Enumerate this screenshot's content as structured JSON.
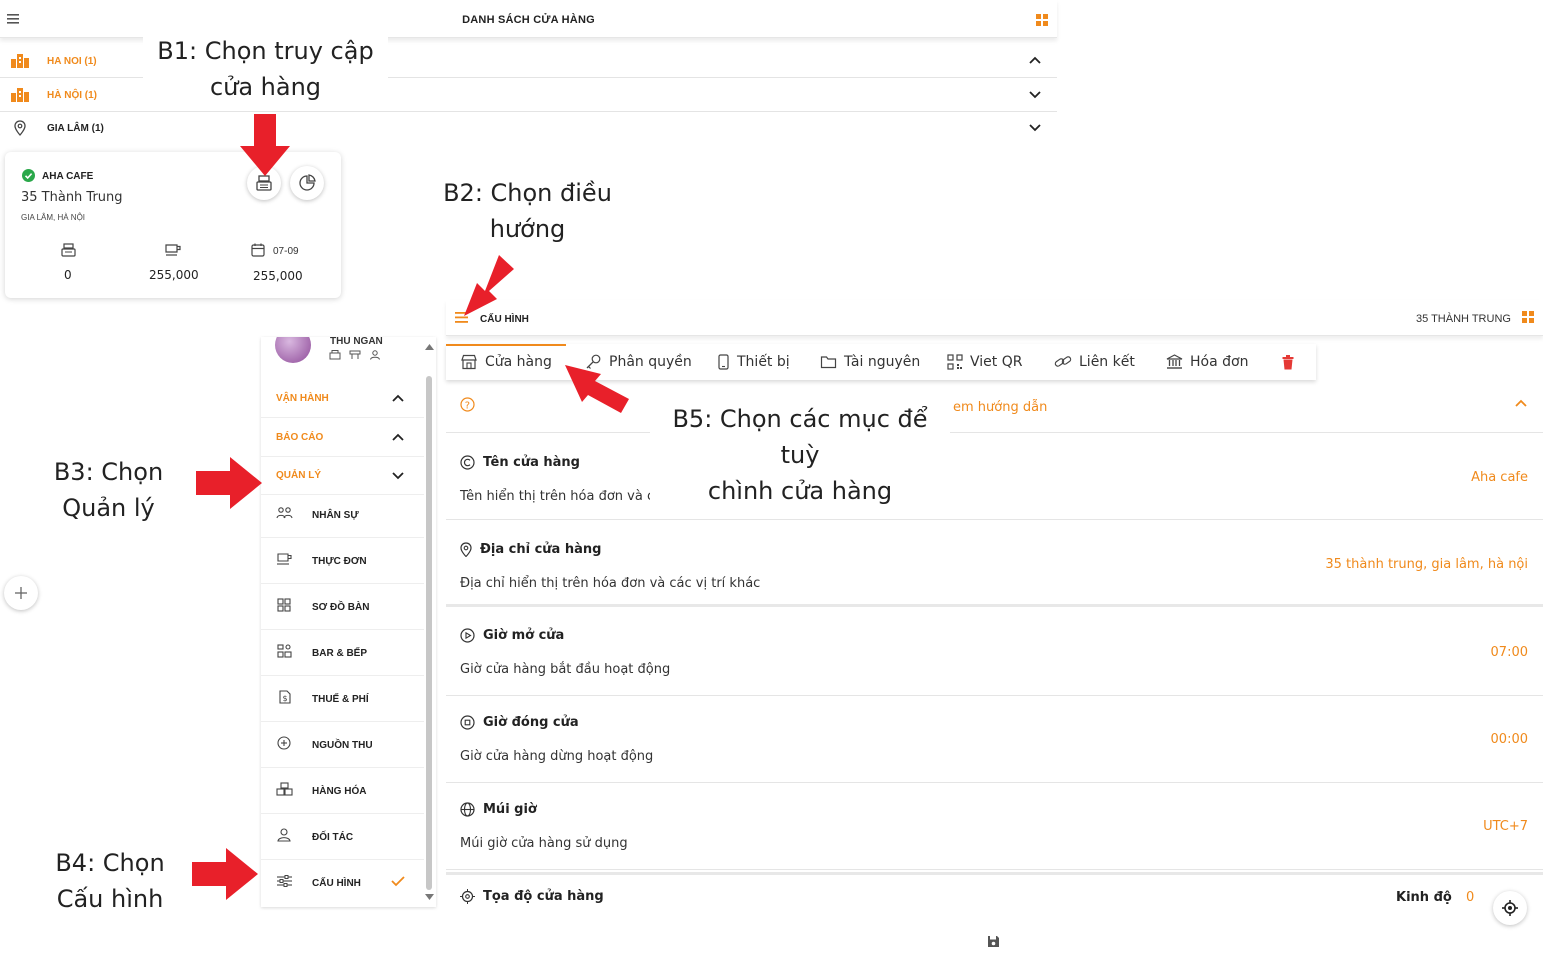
{
  "store_list": {
    "title": "DANH SÁCH CỬA HÀNG",
    "regions": [
      {
        "label": "HA NOI (1)"
      },
      {
        "label": "HÀ NỘI (1)"
      },
      {
        "label": "GIA LÂM (1)"
      }
    ],
    "store": {
      "name": "AHA CAFE",
      "address": "35 Thành Trung",
      "district": "GIA LÂM, HÀ NỘI",
      "date": "07-09",
      "stats": [
        "0",
        "255,000",
        "255,000"
      ]
    }
  },
  "annotations": {
    "b1": "B1: Chọn truy cập\ncửa hàng",
    "b2": "B2: Chọn điều\nhướng",
    "b3": "B3: Chọn\nQuản lý",
    "b4": "B4: Chọn\nCấu hình",
    "b5": "B5: Chọn các mục để tuỳ\nchình cửa hàng"
  },
  "sidebar": {
    "user_label": "THU NGÂN",
    "sections": [
      {
        "label": "VẬN HÀNH"
      },
      {
        "label": "BÁO CÁO"
      },
      {
        "label": "QUẢN LÝ"
      }
    ],
    "items": [
      {
        "label": "NHÂN SỰ",
        "icon": "people-icon"
      },
      {
        "label": "THỰC ĐƠN",
        "icon": "cup-icon"
      },
      {
        "label": "SƠ ĐỒ BÀN",
        "icon": "grid-icon"
      },
      {
        "label": "BAR & BẾP",
        "icon": "kitchen-icon"
      },
      {
        "label": "THUẾ & PHÍ",
        "icon": "tax-icon"
      },
      {
        "label": "NGUỒN THU",
        "icon": "plus-circle-icon"
      },
      {
        "label": "HÀNG HÓA",
        "icon": "boxes-icon"
      },
      {
        "label": "ĐỐI TÁC",
        "icon": "partner-icon"
      },
      {
        "label": "CẤU HÌNH",
        "icon": "sliders-icon"
      }
    ]
  },
  "config": {
    "title": "CẤU HÌNH",
    "store_name": "35 THÀNH TRUNG",
    "tabs": [
      {
        "label": "Cửa hàng",
        "icon": "store-icon"
      },
      {
        "label": "Phân quyền",
        "icon": "key-icon"
      },
      {
        "label": "Thiết bị",
        "icon": "phone-icon"
      },
      {
        "label": "Tài nguyên",
        "icon": "folder-icon"
      },
      {
        "label": "Viet QR",
        "icon": "qr-icon"
      },
      {
        "label": "Liên kết",
        "icon": "link-icon"
      },
      {
        "label": "Hóa đơn",
        "icon": "bank-icon"
      }
    ],
    "guide_text": "em hướng dẫn",
    "rows": [
      {
        "title": "Tên cửa hàng",
        "desc": "Tên hiển thị trên hóa đơn và các vị trí khác",
        "value": "Aha cafe"
      },
      {
        "title": "Địa chỉ cửa hàng",
        "desc": "Địa chỉ hiển thị trên hóa đơn và các vị trí khác",
        "value": "35 thành trung, gia lâm, hà nội"
      },
      {
        "title": "Giờ mở cửa",
        "desc": "Giờ cửa hàng bắt đầu hoạt động",
        "value": "07:00"
      },
      {
        "title": "Giờ đóng cửa",
        "desc": "Giờ cửa hàng dừng hoạt động",
        "value": "00:00"
      },
      {
        "title": "Múi giờ",
        "desc": "Múi giờ cửa hàng sử dụng",
        "value": "UTC+7"
      }
    ],
    "coord": {
      "title": "Tọa độ cửa hàng",
      "longitude_label": "Kinh độ",
      "longitude_value": "0"
    }
  },
  "colors": {
    "accent": "#f08a1c",
    "arrow": "#e8202a",
    "success": "#2aa84a",
    "delete": "#e53935"
  }
}
